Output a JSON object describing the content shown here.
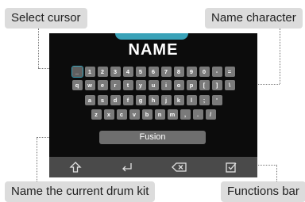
{
  "callouts": {
    "select_cursor": "Select cursor",
    "name_character": "Name character",
    "name_kit": "Name the current drum kit",
    "functions_bar": "Functions bar"
  },
  "screen": {
    "title": "NAME",
    "name_value": "Fusion",
    "keyboard": {
      "row1": [
        "_",
        "1",
        "2",
        "3",
        "4",
        "5",
        "6",
        "7",
        "8",
        "9",
        "0",
        "-",
        "="
      ],
      "row2": [
        "q",
        "w",
        "e",
        "r",
        "t",
        "y",
        "u",
        "i",
        "o",
        "p",
        "[",
        "]",
        "\\"
      ],
      "row3": [
        "a",
        "s",
        "d",
        "f",
        "g",
        "h",
        "j",
        "k",
        "l",
        ";",
        "'"
      ],
      "row4": [
        "z",
        "x",
        "c",
        "v",
        "b",
        "n",
        "m",
        ",",
        ".",
        "/"
      ],
      "selected": "_"
    },
    "functions": [
      {
        "icon": "shift-arrow-icon"
      },
      {
        "icon": "return-icon"
      },
      {
        "icon": "backspace-icon"
      },
      {
        "icon": "confirm-checkbox-icon"
      }
    ]
  },
  "colors": {
    "accent": "#3aa2b8",
    "screen_bg": "#0c0c0c",
    "key": "#7a7a7a",
    "callout_bg": "#dcdcdc"
  }
}
